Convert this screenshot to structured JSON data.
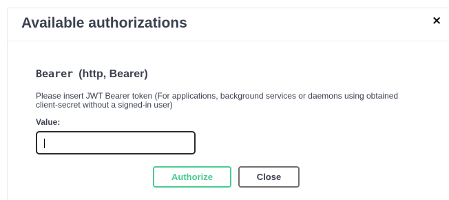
{
  "modal": {
    "title": "Available authorizations",
    "close_symbol": "×"
  },
  "scheme": {
    "name": "Bearer",
    "type": "(http, Bearer)",
    "description": "Please insert JWT Bearer token (For applications, background services or daemons using obtained client-secret without a signed-in user)",
    "value_label": "Value:",
    "value": "",
    "value_placeholder": ""
  },
  "buttons": {
    "authorize_label": "Authorize",
    "close_label": "Close"
  },
  "colors": {
    "authorize_accent": "#49cc90",
    "text": "#3b4151"
  }
}
